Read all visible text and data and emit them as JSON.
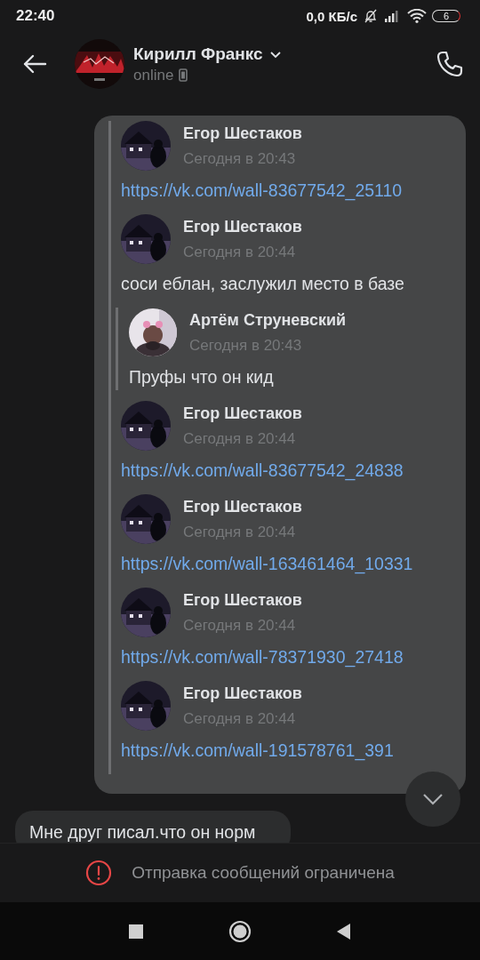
{
  "status_bar": {
    "time": "22:40",
    "net_speed": "0,0 КБ/с",
    "battery": "6"
  },
  "header": {
    "name": "Кирилл Франкс",
    "status": "online"
  },
  "forwarded": [
    {
      "author": "Егор Шестаков",
      "time": "Сегодня в 20:43",
      "kind": "link",
      "text": "https://vk.com/wall-83677542_25110"
    },
    {
      "author": "Егор Шестаков",
      "time": "Сегодня в 20:44",
      "kind": "text",
      "text": "соси еблан, заслужил место в базе",
      "children": [
        {
          "author": "Артём Струневский",
          "time": "Сегодня в 20:43",
          "kind": "text",
          "text": "Пруфы что он кид"
        }
      ]
    },
    {
      "author": "Егор Шестаков",
      "time": "Сегодня в 20:44",
      "kind": "link",
      "text": "https://vk.com/wall-83677542_24838"
    },
    {
      "author": "Егор Шестаков",
      "time": "Сегодня в 20:44",
      "kind": "link",
      "text": "https://vk.com/wall-163461464_10331"
    },
    {
      "author": "Егор Шестаков",
      "time": "Сегодня в 20:44",
      "kind": "link",
      "text": "https://vk.com/wall-78371930_27418"
    },
    {
      "author": "Егор Шестаков",
      "time": "Сегодня в 20:44",
      "kind": "link",
      "text": "https://vk.com/wall-191578761_391"
    }
  ],
  "incoming": {
    "text": "Мне друг писал.что он норм"
  },
  "notice": {
    "text": "Отправка сообщений ограничена"
  }
}
